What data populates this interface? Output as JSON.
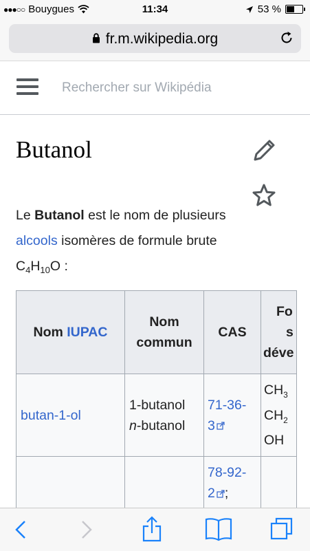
{
  "status": {
    "carrier": "Bouygues",
    "time": "11:34",
    "battery": "53 %",
    "battery_level": 0.53
  },
  "browser": {
    "url": "fr.m.wikipedia.org"
  },
  "header": {
    "search_placeholder": "Rechercher sur Wikipédia"
  },
  "article": {
    "title": "Butanol",
    "intro": {
      "le": "Le ",
      "bold": "Butanol",
      "text1": " est le nom de plusieurs ",
      "link": "alcools",
      "text2": " isomères de formule brute C",
      "sub1": "4",
      "h": "H",
      "sub2": "10",
      "tail": "O :"
    }
  },
  "table": {
    "headers": {
      "nom_prefix": "Nom ",
      "iupac": "IUPAC",
      "nom_commun_1": "Nom",
      "nom_commun_2": "commun",
      "cas": "CAS",
      "formule_1": "Fo",
      "formule_2": "s",
      "formule_3": "déve"
    },
    "row1": {
      "iupac": "butan-1-ol",
      "commun_1": "1-butanol",
      "commun_2_italic": "n",
      "commun_2_rest": "-butanol",
      "cas_1": "71-36-",
      "cas_2": "3",
      "formula_1": "CH",
      "formula_1_sub": "3",
      "formula_2": "CH",
      "formula_2_sub": "2",
      "formula_3": "OH"
    },
    "row2": {
      "cas_1": "78-92-",
      "cas_2": "2",
      "cas_tail": ";"
    }
  },
  "colors": {
    "link": "#3366cc",
    "toolbar_icon": "#1a82fb"
  }
}
